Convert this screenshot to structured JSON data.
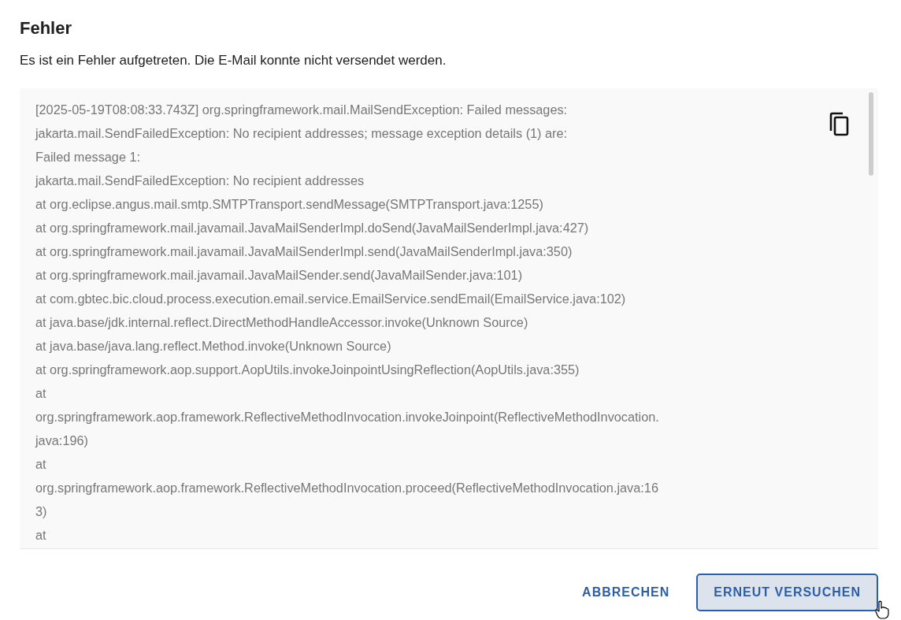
{
  "dialog": {
    "title": "Fehler",
    "message": "Es ist ein Fehler aufgetreten. Die E-Mail konnte nicht versendet werden.",
    "log_lines": [
      "[2025-05-19T08:08:33.743Z] org.springframework.mail.MailSendException: Failed messages:",
      "jakarta.mail.SendFailedException: No recipient addresses; message exception details (1) are:",
      "Failed message 1:",
      "jakarta.mail.SendFailedException: No recipient addresses",
      "at org.eclipse.angus.mail.smtp.SMTPTransport.sendMessage(SMTPTransport.java:1255)",
      "at org.springframework.mail.javamail.JavaMailSenderImpl.doSend(JavaMailSenderImpl.java:427)",
      "at org.springframework.mail.javamail.JavaMailSenderImpl.send(JavaMailSenderImpl.java:350)",
      "at org.springframework.mail.javamail.JavaMailSender.send(JavaMailSender.java:101)",
      "at com.gbtec.bic.cloud.process.execution.email.service.EmailService.sendEmail(EmailService.java:102)",
      "at java.base/jdk.internal.reflect.DirectMethodHandleAccessor.invoke(Unknown Source)",
      "at java.base/java.lang.reflect.Method.invoke(Unknown Source)",
      "at org.springframework.aop.support.AopUtils.invokeJoinpointUsingReflection(AopUtils.java:355)",
      "at",
      "org.springframework.aop.framework.ReflectiveMethodInvocation.invokeJoinpoint(ReflectiveMethodInvocation.",
      "java:196)",
      "at",
      "org.springframework.aop.framework.ReflectiveMethodInvocation.proceed(ReflectiveMethodInvocation.java:16",
      "3)",
      "at"
    ],
    "buttons": [
      {
        "label": "ABBRECHEN",
        "kind": "text"
      },
      {
        "label": "ERNEUT VERSUCHEN",
        "kind": "outlined"
      }
    ]
  }
}
